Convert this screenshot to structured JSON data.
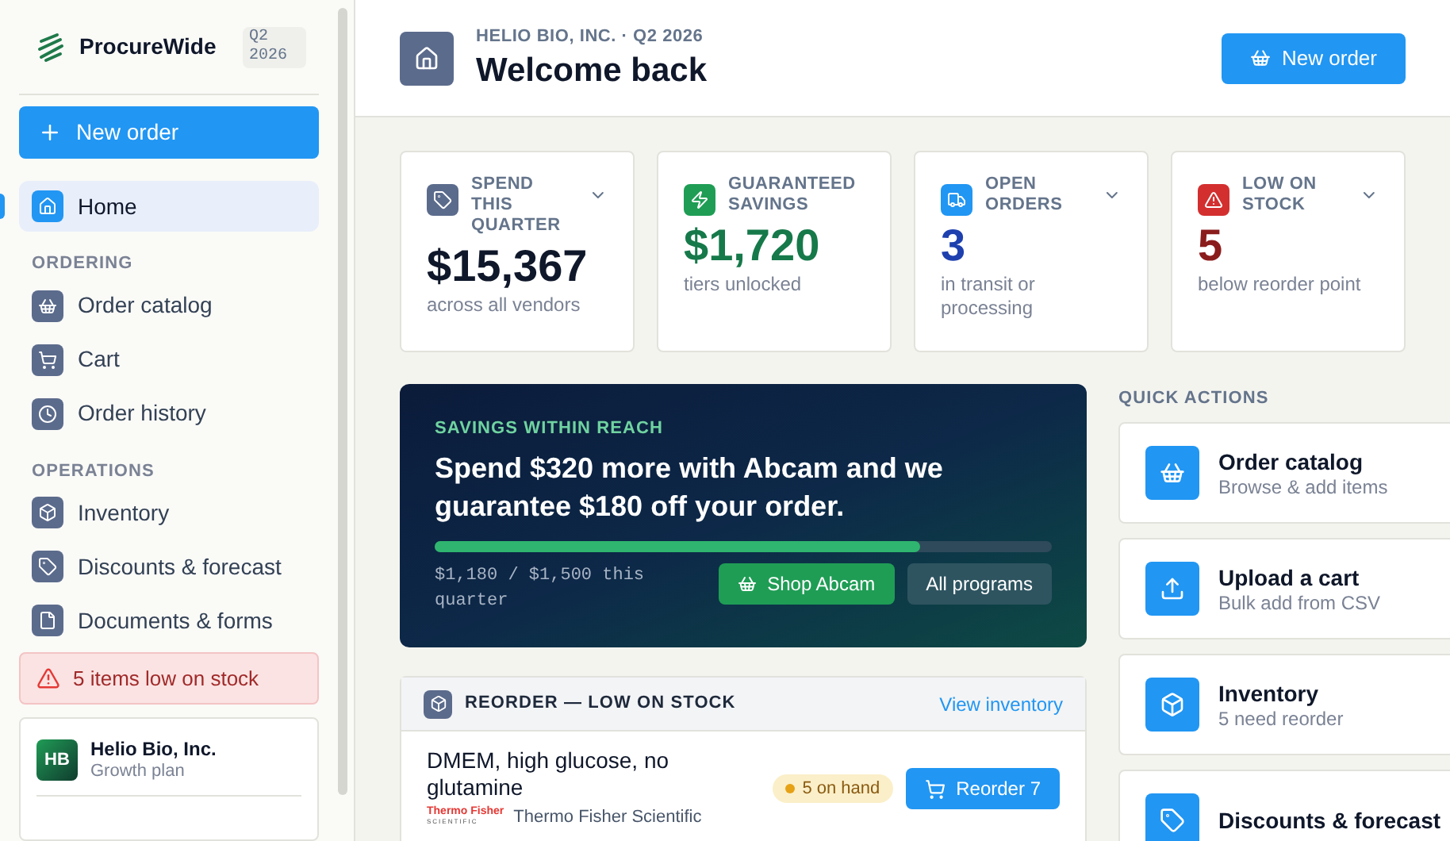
{
  "sidebar": {
    "brand": "ProcureWide",
    "period_badge": "Q2 2026",
    "new_order_button": "New order",
    "items": [
      {
        "label": "Home",
        "selected": true
      }
    ],
    "sections": [
      {
        "title": "ORDERING",
        "items": [
          {
            "label": "Order catalog",
            "selected": false
          },
          {
            "label": "Cart",
            "selected": false
          },
          {
            "label": "Order history",
            "selected": false
          }
        ]
      },
      {
        "title": "OPERATIONS",
        "items": [
          {
            "label": "Inventory",
            "selected": false
          },
          {
            "label": "Discounts & forecast",
            "selected": false
          },
          {
            "label": "Documents & forms",
            "selected": false
          }
        ]
      }
    ],
    "alert": "5 items low on stock",
    "org": {
      "initials": "HB",
      "name": "Helio Bio, Inc.",
      "plan": "Growth plan"
    }
  },
  "header": {
    "breadcrumb": "HELIO BIO, INC. · Q2 2026",
    "title": "Welcome back",
    "button": "New order"
  },
  "stats": [
    {
      "label": "SPEND THIS QUARTER",
      "value": "$15,367",
      "caption": "across all vendors",
      "color": "#0f172a"
    },
    {
      "label": "GUARANTEED SAVINGS",
      "value": "$1,720",
      "caption": "tiers unlocked",
      "color": "#16794a"
    },
    {
      "label": "OPEN ORDERS",
      "value": "3",
      "caption": "in transit or processing",
      "color": "#1e40af"
    },
    {
      "label": "LOW ON STOCK",
      "value": "5",
      "caption": "below reorder point",
      "color": "#8b1c1c"
    }
  ],
  "banner": {
    "eyebrow": "SAVINGS WITHIN REACH",
    "headline": "Spend $320 more with Abcam and we guarantee $180 off your order.",
    "level": 0.787,
    "progress_text": "$1,180 / $1,500 this quarter",
    "primary_button": "Shop Abcam",
    "secondary_button": "All programs"
  },
  "reorder": {
    "title": "REORDER — LOW ON STOCK",
    "link": "View inventory",
    "rows": [
      {
        "name": "DMEM, high glucose, no glutamine",
        "logo_line_1": "Thermo Fisher",
        "logo_line_2": "SCIENTIFIC",
        "vendor": "Thermo Fisher Scientific",
        "badge": "5 on hand",
        "button": "Reorder 7"
      }
    ]
  },
  "quick_actions": {
    "title": "QUICK ACTIONS",
    "items": [
      {
        "title": "Order catalog",
        "subtitle": "Browse & add items"
      },
      {
        "title": "Upload a cart",
        "subtitle": "Bulk add from CSV"
      },
      {
        "title": "Inventory",
        "subtitle": "5 need reorder"
      },
      {
        "title": "Discounts & forecast"
      }
    ]
  }
}
